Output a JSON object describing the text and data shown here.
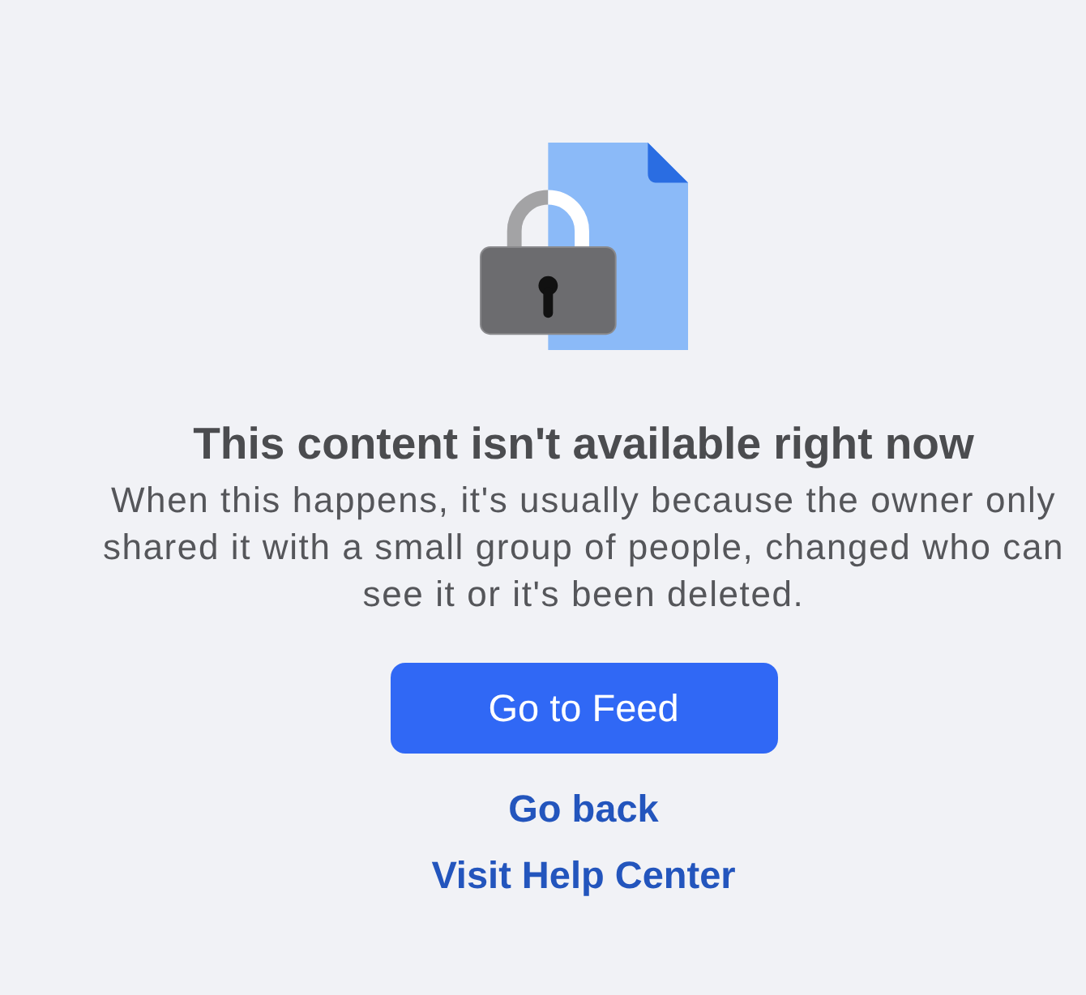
{
  "title": "This content isn't available right now",
  "message": "When this happens, it's usually because the owner only shared it with a small group of people, changed who can see it or it's been deleted.",
  "actions": [
    {
      "label": "Go to Feed",
      "kind": "primary"
    },
    {
      "label": "Go back",
      "kind": "link"
    },
    {
      "label": "Visit Help Center",
      "kind": "link"
    }
  ]
}
